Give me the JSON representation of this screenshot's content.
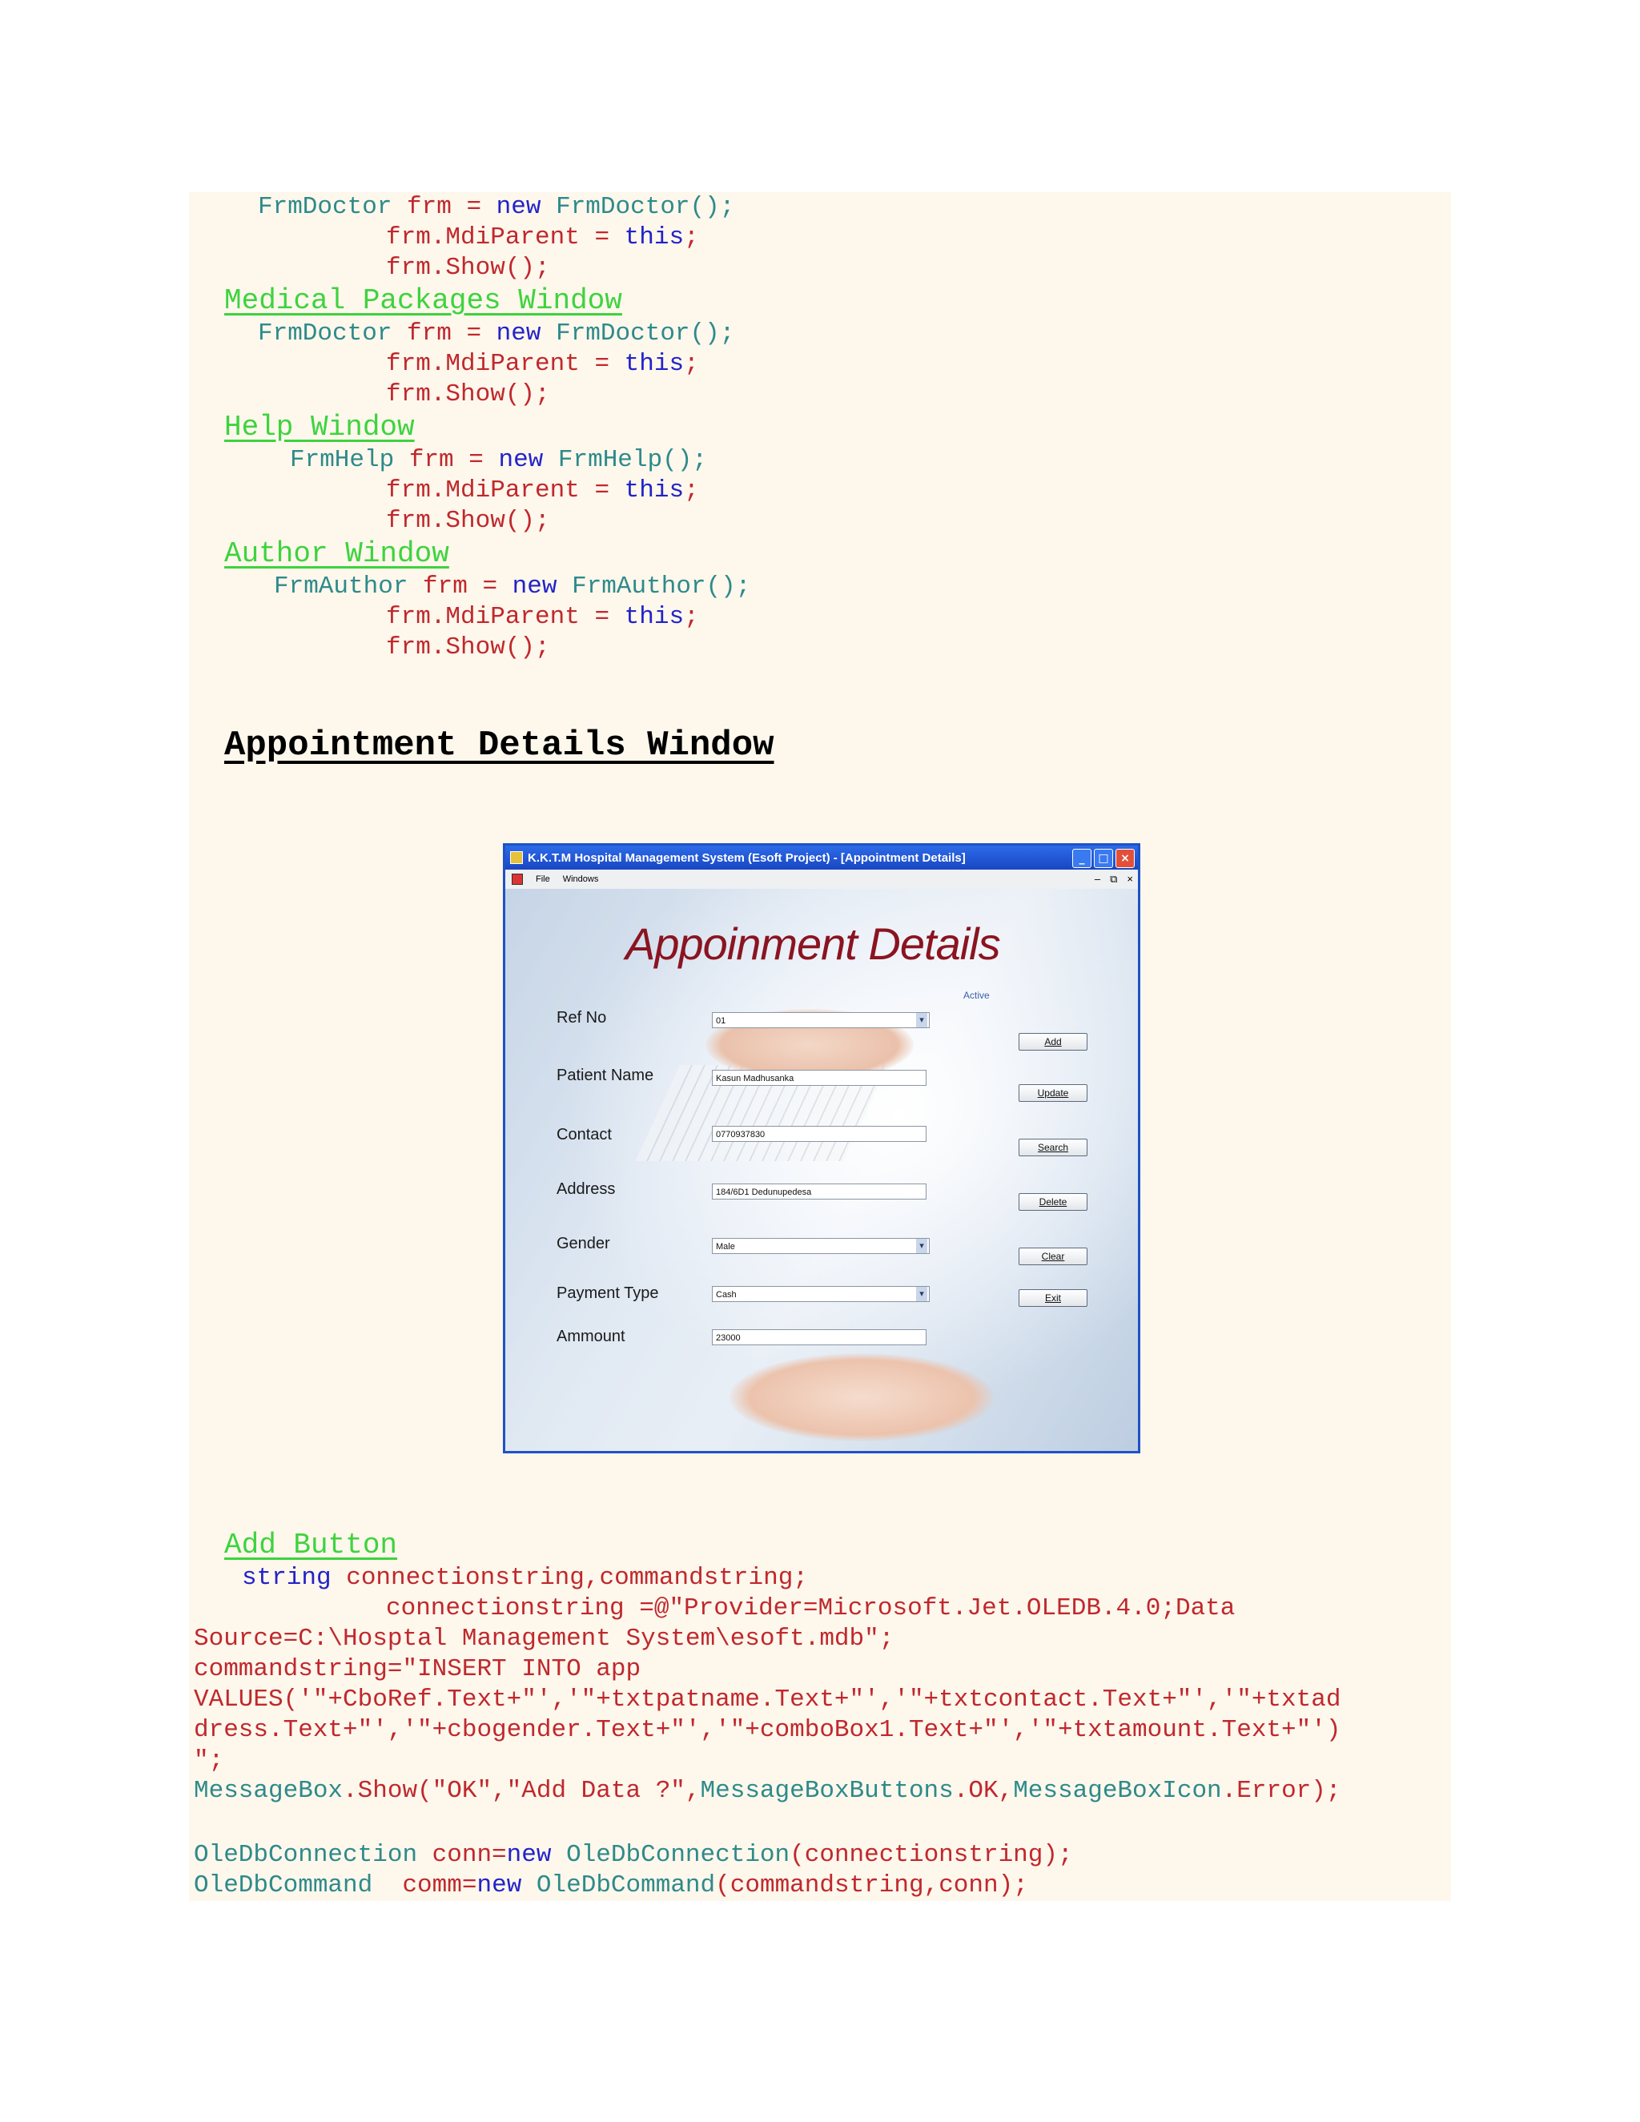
{
  "links": {
    "medical": "Medical Packages Window",
    "help": "Help Window",
    "author": "Author Window",
    "add": "Add Button"
  },
  "heading": "Appointment Details Window",
  "code": {
    "frmdoctor_type": "FrmDoctor",
    "frm_eq": " frm = ",
    "new_kw": "new",
    "frmdoctor_ctor": "FrmDoctor();",
    "mdi_pre": "frm.MdiParent = ",
    "this_kw": "this",
    "semi": ";",
    "show": "frm.Show();",
    "frmhelp_type": "FrmHelp",
    "frmhelp_ctor": "FrmHelp();",
    "frmauthor_type": "FrmAuthor",
    "frmauthor_ctor": "FrmAuthor();",
    "string_kw": "string",
    "decl": " connectionstring,commandstring;",
    "conn_assign": "connectionstring =@\"Provider=Microsoft.Jet.OLEDB.4.0;Data",
    "source": "Source=C:\\Hosptal Management System\\esoft.mdb\";",
    "cmd1": "commandstring=\"INSERT INTO app",
    "cmd2": "VALUES('\"+CboRef.Text+\"','\"+txtpatname.Text+\"','\"+txtcontact.Text+\"','\"+txtad",
    "cmd3": "dress.Text+\"','\"+cbogender.Text+\"','\"+comboBox1.Text+\"','\"+txtamount.Text+\"')",
    "cmd4": "\";",
    "mb_type": "MessageBox",
    "mb_show": ".Show(\"OK\",\"Add Data ?\",",
    "mb_buttons": "MessageBoxButtons",
    "mb_ok": ".OK,",
    "mb_icon": "MessageBoxIcon",
    "mb_err": ".Error);",
    "oledbconn_type": "OleDbConnection",
    "conn_var": " conn=",
    "conn_args": "(connectionstring);",
    "oledbcmd_type": "OleDbCommand",
    "comm_var": "  comm=",
    "comm_args": "(commandstring,conn);"
  },
  "window": {
    "title": "K.K.T.M Hospital Management System (Esoft Project) - [Appointment Details]",
    "menu_file": "File",
    "menu_windows": "Windows",
    "app_title": "Appoinment Details",
    "active_label": "Active",
    "labels": {
      "ref": "Ref No",
      "patient": "Patient Name",
      "contact": "Contact",
      "address": "Address",
      "gender": "Gender",
      "payment": "Payment Type",
      "amount": "Ammount"
    },
    "values": {
      "ref": "01",
      "patient": "Kasun Madhusanka",
      "contact": "0770937830",
      "address": "184/6D1 Dedunupedesa",
      "gender": "Male",
      "payment": "Cash",
      "amount": "23000"
    },
    "buttons": {
      "add": "Add",
      "update": "Update",
      "search": "Search",
      "delete": "Delete",
      "clear": "Clear",
      "exit": "Exit"
    }
  }
}
